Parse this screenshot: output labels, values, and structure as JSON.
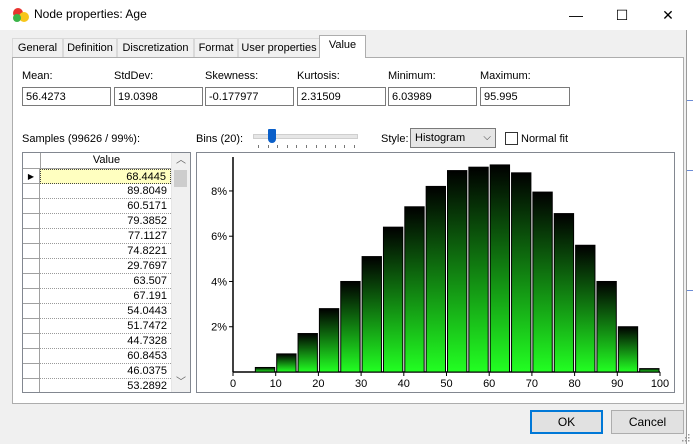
{
  "window": {
    "title": "Node properties: Age",
    "minimize_glyph": "—",
    "maximize_glyph": "☐",
    "close_glyph": "✕"
  },
  "tabs": [
    {
      "label": "General"
    },
    {
      "label": "Definition"
    },
    {
      "label": "Discretization"
    },
    {
      "label": "Format"
    },
    {
      "label": "User properties"
    },
    {
      "label": "Value",
      "active": true
    }
  ],
  "stats": {
    "mean": {
      "label": "Mean:",
      "value": "56.4273"
    },
    "stddev": {
      "label": "StdDev:",
      "value": "19.0398"
    },
    "skewness": {
      "label": "Skewness:",
      "value": "-0.177977"
    },
    "kurtosis": {
      "label": "Kurtosis:",
      "value": "2.31509"
    },
    "minimum": {
      "label": "Minimum:",
      "value": "6.03989"
    },
    "maximum": {
      "label": "Maximum:",
      "value": "95.995"
    }
  },
  "controls": {
    "samples_label": "Samples (99626 / 99%):",
    "bins_label": "Bins (20):",
    "bins_value": 20,
    "style_label": "Style:",
    "style_value": "Histogram",
    "normal_fit_label": "Normal fit",
    "normal_fit_checked": false
  },
  "samples": {
    "column_header": "Value",
    "current_row_marker": "▶",
    "rows": [
      "68.4445",
      "89.8049",
      "60.5171",
      "79.3852",
      "77.1127",
      "74.8221",
      "29.7697",
      "63.507",
      "67.191",
      "54.0443",
      "51.7472",
      "44.7328",
      "60.8453",
      "46.0375",
      "53.2892"
    ]
  },
  "chart_data": {
    "type": "bar",
    "x_ticks": [
      "0",
      "10",
      "20",
      "30",
      "40",
      "50",
      "60",
      "70",
      "80",
      "90",
      "100"
    ],
    "y_ticks": [
      "2%",
      "4%",
      "6%",
      "8%"
    ],
    "xlim": [
      0,
      100
    ],
    "ylim": [
      0,
      9.5
    ],
    "bin_width": 5,
    "bins_start": [
      5,
      10,
      15,
      20,
      25,
      30,
      35,
      40,
      45,
      50,
      55,
      60,
      65,
      70,
      75,
      80,
      85,
      90,
      95
    ],
    "values": [
      0.2,
      0.8,
      1.7,
      2.8,
      4.0,
      5.1,
      6.4,
      7.3,
      8.2,
      8.9,
      9.05,
      9.15,
      8.8,
      7.95,
      7.0,
      5.6,
      4.0,
      2.0,
      0.15
    ],
    "bar_color_top": "#000000",
    "bar_color_bottom": "#22ff22",
    "grid": false
  },
  "buttons": {
    "ok": "OK",
    "cancel": "Cancel"
  }
}
